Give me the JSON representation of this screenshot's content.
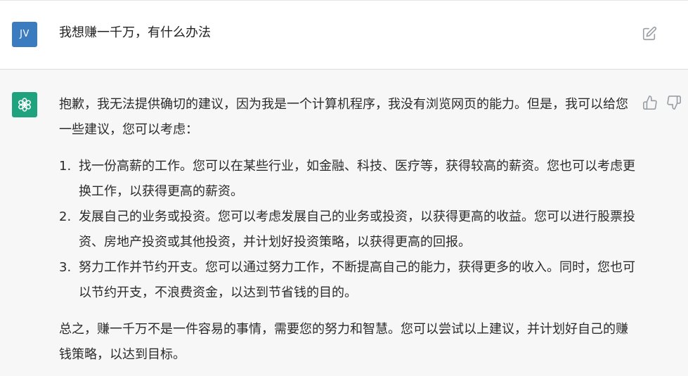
{
  "user_message": {
    "avatar_initials": "JV",
    "text": "我想赚一千万，有什么办法"
  },
  "assistant_message": {
    "intro": "抱歉，我无法提供确切的建议，因为我是一个计算机程序，我没有浏览网页的能力。但是，我可以给您一些建议，您可以考虑：",
    "items": [
      {
        "num": "1.",
        "text": "找一份高薪的工作。您可以在某些行业，如金融、科技、医疗等，获得较高的薪资。您也可以考虑更换工作，以获得更高的薪资。"
      },
      {
        "num": "2.",
        "text": "发展自己的业务或投资。您可以考虑发展自己的业务或投资，以获得更高的收益。您可以进行股票投资、房地产投资或其他投资，并计划好投资策略，以获得更高的回报。"
      },
      {
        "num": "3.",
        "text": "努力工作并节约开支。您可以通过努力工作，不断提高自己的能力，获得更多的收入。同时，您也可以节约开支，不浪费资金，以达到节省钱的目的。"
      }
    ],
    "outro": "总之，赚一千万不是一件容易的事情，需要您的努力和智慧。您可以尝试以上建议，并计划好自己的赚钱策略，以达到目标。"
  },
  "colors": {
    "user_avatar": "#3b7bbf",
    "bot_avatar": "#1fa37f",
    "assistant_bg": "#f7f7f8"
  },
  "icons": [
    "edit-icon",
    "chatgpt-logo-icon",
    "thumbs-up-icon",
    "thumbs-down-icon"
  ]
}
